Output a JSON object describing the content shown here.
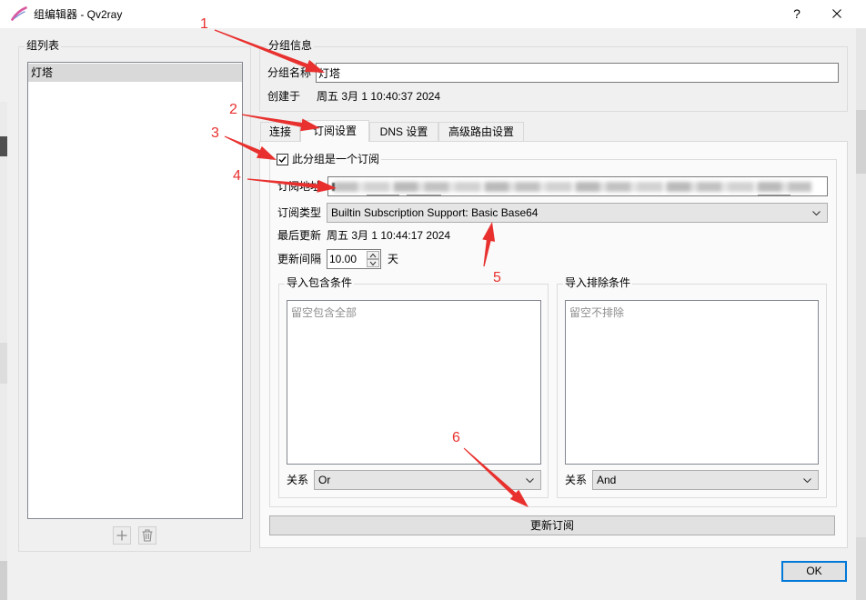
{
  "window": {
    "title": "组编辑器 - Qv2ray",
    "help_label": "?",
    "icon": "qv2ray-logo-icon",
    "close_icon": "close-icon"
  },
  "group_list": {
    "title": "组列表",
    "items": [
      {
        "label": "灯塔",
        "selected": true
      }
    ],
    "add_icon": "plus-icon",
    "delete_icon": "trash-icon"
  },
  "group_info": {
    "title": "分组信息",
    "name_label": "分组名称",
    "name_value": "灯塔",
    "created_label": "创建于",
    "created_value": "周五 3月 1 10:40:37 2024"
  },
  "tabs": [
    {
      "label": "连接",
      "active": false
    },
    {
      "label": "订阅设置",
      "active": true
    },
    {
      "label": "DNS 设置",
      "active": false
    },
    {
      "label": "高级路由设置",
      "active": false
    }
  ],
  "subscription": {
    "enabled_label": "此分组是一个订阅",
    "enabled": true,
    "address_label": "订阅地址",
    "type_label": "订阅类型",
    "type_value": "Builtin Subscription Support: Basic Base64",
    "last_update_label": "最后更新",
    "last_update_value": "周五 3月 1 10:44:17 2024",
    "interval_label": "更新间隔",
    "interval_value": "10.00",
    "interval_unit": "天",
    "include": {
      "title": "导入包含条件",
      "placeholder": "留空包含全部",
      "relation_label": "关系",
      "relation_value": "Or"
    },
    "exclude": {
      "title": "导入排除条件",
      "placeholder": "留空不排除",
      "relation_label": "关系",
      "relation_value": "And"
    },
    "update_button": "更新订阅"
  },
  "ok_button": "OK",
  "annotations": {
    "color": "#e8312f",
    "labels": [
      "1",
      "2",
      "3",
      "4",
      "5",
      "6"
    ]
  },
  "colors": {
    "default_button_border": "#0078d7",
    "list_selection": "#d9d9d9"
  }
}
